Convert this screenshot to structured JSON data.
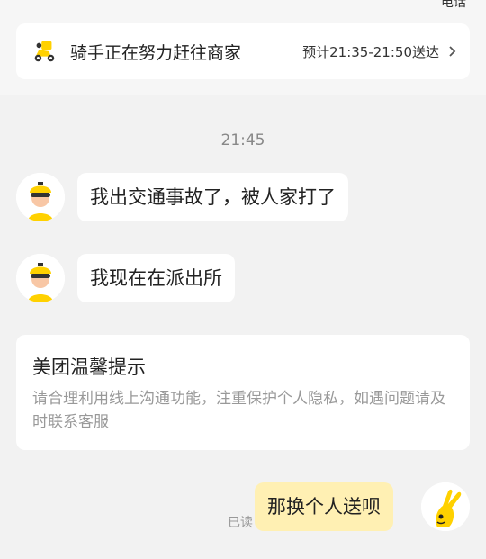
{
  "header": {
    "top_right_text": "电话"
  },
  "status_card": {
    "icon": "delivery-scooter-icon",
    "status": "骑手正在努力赶往商家",
    "eta": "预计21:35-21:50送达"
  },
  "chat": {
    "time_label": "21:45",
    "rider_messages": [
      "我出交通事故了，被人家打了",
      "我现在在派出所"
    ],
    "tip": {
      "title": "美团温馨提示",
      "body": "请合理利用线上沟通功能，注重保护个人隐私，如遇问题请及时联系客服"
    },
    "my_message": "那换个人送呗",
    "read_label": "已读"
  },
  "colors": {
    "brand_yellow": "#ffd100",
    "my_bubble": "#fff0b3",
    "background": "#f2f2f2"
  }
}
